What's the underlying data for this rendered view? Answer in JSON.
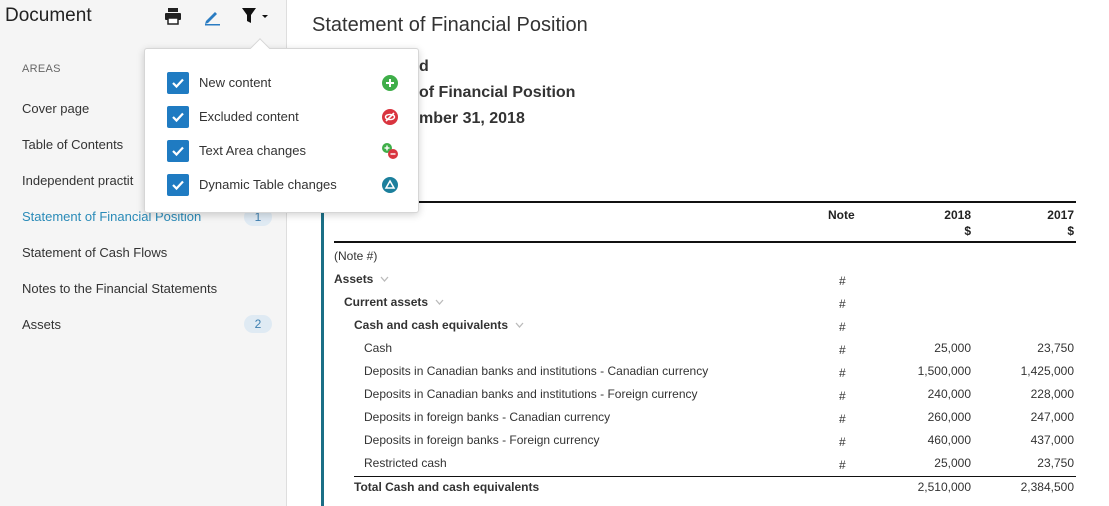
{
  "sidebar": {
    "title": "Document",
    "areas_label": "AREAS",
    "items": [
      {
        "label": "Cover page"
      },
      {
        "label": "Table of Contents"
      },
      {
        "label": "Independent practit"
      },
      {
        "label": "Statement of Financial Position",
        "badge": "1"
      },
      {
        "label": "Statement of Cash Flows"
      },
      {
        "label": "Notes to the Financial Statements"
      },
      {
        "label": "Assets",
        "badge": "2"
      }
    ]
  },
  "toolbar": {
    "icons": [
      "print-icon",
      "edit-pencil-icon",
      "filter-icon",
      "caret-down-icon"
    ]
  },
  "filter_popover": {
    "options": [
      {
        "label": "New content",
        "checked": true,
        "icon": "plus-circle-icon",
        "color": "#3fae49"
      },
      {
        "label": "Excluded content",
        "checked": true,
        "icon": "eye-slash-circle-icon",
        "color": "#d9343f"
      },
      {
        "label": "Text Area changes",
        "checked": true,
        "icon": "plus-minus-icon",
        "color": "#d9343f"
      },
      {
        "label": "Dynamic Table changes",
        "checked": true,
        "icon": "triangle-circle-icon",
        "color": "#1b7f9c"
      }
    ]
  },
  "main": {
    "title": "Statement of Financial Position",
    "heading_1": "d",
    "heading_2": "of Financial Position",
    "heading_3": "mber 31, 2018"
  },
  "table": {
    "headers": {
      "note": "Note",
      "y2018": "2018",
      "y2017": "2017",
      "currency_2018": "$",
      "currency_2017": "$"
    },
    "note_ref": "(Note #)",
    "rows": [
      {
        "label": "Assets",
        "note": "#",
        "v2018": "",
        "v2017": "",
        "bold": true,
        "chevron": true,
        "indent": 0
      },
      {
        "label": "Current assets",
        "note": "#",
        "v2018": "",
        "v2017": "",
        "bold": true,
        "chevron": true,
        "indent": 1
      },
      {
        "label": "Cash and cash equivalents",
        "note": "#",
        "v2018": "",
        "v2017": "",
        "bold": true,
        "chevron": true,
        "indent": 2
      },
      {
        "label": "Cash",
        "note": "#",
        "v2018": "25,000",
        "v2017": "23,750",
        "indent": 3
      },
      {
        "label": "Deposits in Canadian banks and institutions - Canadian currency",
        "note": "#",
        "v2018": "1,500,000",
        "v2017": "1,425,000",
        "indent": 3
      },
      {
        "label": "Deposits in Canadian banks and institutions - Foreign currency",
        "note": "#",
        "v2018": "240,000",
        "v2017": "228,000",
        "indent": 3
      },
      {
        "label": "Deposits in foreign banks - Canadian currency",
        "note": "#",
        "v2018": "260,000",
        "v2017": "247,000",
        "indent": 3
      },
      {
        "label": "Deposits in foreign banks - Foreign currency",
        "note": "#",
        "v2018": "460,000",
        "v2017": "437,000",
        "indent": 3
      },
      {
        "label": "Restricted cash",
        "note": "#",
        "v2018": "25,000",
        "v2017": "23,750",
        "indent": 3
      },
      {
        "label": "Total Cash and cash equivalents",
        "note": "",
        "v2018": "2,510,000",
        "v2017": "2,384,500",
        "bold": true,
        "indent": 2
      }
    ]
  }
}
